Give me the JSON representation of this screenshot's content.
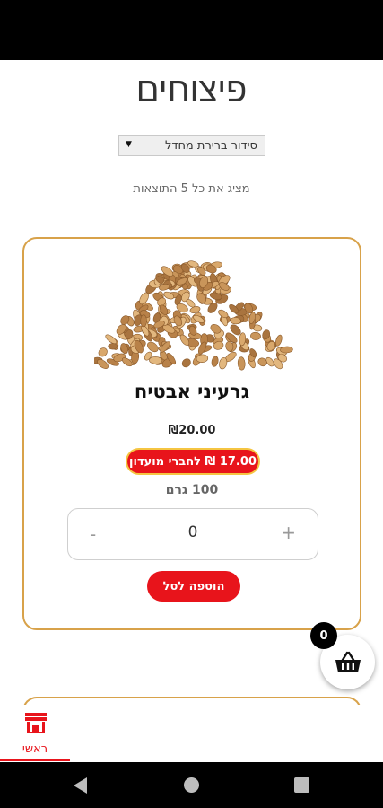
{
  "page": {
    "title": "פיצוחים",
    "sort": {
      "selected": "סידור ברירת מחדל"
    },
    "results_count": "מציג את כל 5 התוצאות"
  },
  "product": {
    "name": "גרעיני אבטיח",
    "price": "₪20.00",
    "club_price": "17.00 ₪ לחברי מועדון",
    "weight": "100 גרם",
    "quantity": "0",
    "minus_label": "-",
    "plus_label": "+",
    "add_to_cart": "הוספה לסל"
  },
  "cart": {
    "count": "0"
  },
  "bottom_nav": {
    "home_label": "ראשי"
  },
  "colors": {
    "accent_red": "#e8141b",
    "card_border": "#d8a24a",
    "badge_border": "#f5c542"
  },
  "icons": {
    "cart": "shopping-basket-icon",
    "home": "store-icon",
    "sort_arrow": "triangle-down-icon"
  }
}
